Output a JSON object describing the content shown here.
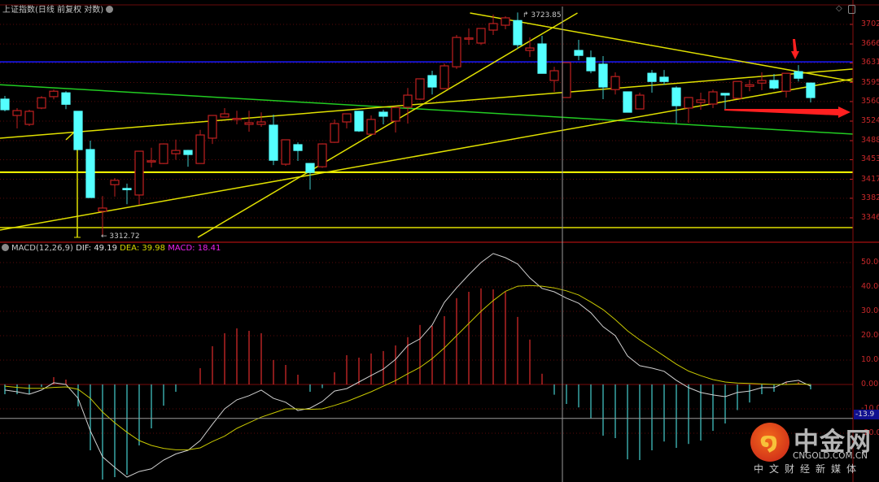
{
  "header": {
    "title": "上证指数(日线 前复权 对数)",
    "macd_label": "MACD(12,26,9)",
    "dif": "DIF: 49.19",
    "dea": "DEA: 39.98",
    "macd": "MACD: 18.41"
  },
  "annotations": {
    "high_label": "3723.85",
    "low_label": "3312.72",
    "cursor_value": "-13.9"
  },
  "watermark": {
    "brand": "中金网",
    "domain": "CNGOLD.COM.CN",
    "slogan": "中文财经新媒体"
  },
  "colors": {
    "up": "#e0302f",
    "down": "#54ffff",
    "dif": "#d0d0d0",
    "dea": "#c8c800",
    "axis": "#c8282a",
    "grid": "#5a0a0a"
  },
  "chart_data": [
    {
      "type": "candlestick",
      "title": "上证指数(日线 前复权 对数)",
      "y_ticks": [
        "3702",
        "3666",
        "3631",
        "3595",
        "3560",
        "3524",
        "3488",
        "3453",
        "3417",
        "3382",
        "3346"
      ],
      "ylim": [
        3300,
        3730
      ],
      "candles_ohlc": [
        [
          3564.4,
          3570.4,
          3542,
          3545
        ],
        [
          3534.4,
          3548,
          3510.5,
          3543.4
        ],
        [
          3518,
          3545,
          3515,
          3542
        ],
        [
          3548,
          3570,
          3546,
          3567
        ],
        [
          3569,
          3582,
          3564,
          3579
        ],
        [
          3576,
          3579,
          3546,
          3555
        ],
        [
          3542,
          3542,
          3471,
          3471.6
        ],
        [
          3471.6,
          3488,
          3383,
          3383.4
        ],
        [
          3358,
          3386,
          3312.72,
          3364
        ],
        [
          3407,
          3419,
          3385,
          3415
        ],
        [
          3400,
          3409,
          3371,
          3399
        ],
        [
          3388,
          3469,
          3370,
          3468.6
        ],
        [
          3450,
          3475,
          3439,
          3451
        ],
        [
          3446,
          3483,
          3445,
          3482
        ],
        [
          3464,
          3490,
          3453,
          3470
        ],
        [
          3470,
          3471,
          3440,
          3462.6
        ],
        [
          3446,
          3508,
          3446,
          3498.5
        ],
        [
          3492.6,
          3535,
          3482,
          3534.4
        ],
        [
          3531.5,
          3548,
          3531,
          3537.4
        ],
        [
          3528,
          3543,
          3518,
          3529
        ],
        [
          3518,
          3543,
          3504.5,
          3521
        ],
        [
          3518,
          3540,
          3513.5,
          3522.5
        ],
        [
          3516.5,
          3536,
          3443,
          3452
        ],
        [
          3444.7,
          3490,
          3441.7,
          3489.6
        ],
        [
          3480.6,
          3485,
          3450.7,
          3470
        ],
        [
          3446,
          3447,
          3398,
          3429.7
        ],
        [
          3440,
          3483,
          3438,
          3482
        ],
        [
          3485,
          3527,
          3484,
          3519.5
        ],
        [
          3522.5,
          3538,
          3510.5,
          3537.4
        ],
        [
          3542,
          3543,
          3504,
          3506
        ],
        [
          3500,
          3534.4,
          3499,
          3527
        ],
        [
          3540.4,
          3545,
          3518,
          3533
        ],
        [
          3524,
          3549.4,
          3503,
          3549
        ],
        [
          3549.4,
          3585,
          3519.5,
          3571.8
        ],
        [
          3564.4,
          3602,
          3563,
          3601.8
        ],
        [
          3607.7,
          3616.7,
          3573,
          3586.8
        ],
        [
          3583.8,
          3630,
          3583,
          3625.7
        ],
        [
          3624,
          3682.5,
          3620,
          3678
        ],
        [
          3675,
          3694.5,
          3664.6,
          3677
        ],
        [
          3667.6,
          3695,
          3664,
          3694.5
        ],
        [
          3691.5,
          3720,
          3682.5,
          3703.5
        ],
        [
          3700.5,
          3717,
          3693,
          3714
        ],
        [
          3709,
          3723.85,
          3657,
          3664.6
        ],
        [
          3654,
          3678,
          3642,
          3658.6
        ],
        [
          3666,
          3681,
          3612,
          3612
        ],
        [
          3598.8,
          3624,
          3577.8,
          3616.7
        ],
        [
          3567.4,
          3632,
          3567,
          3631.7
        ],
        [
          3654,
          3673.6,
          3636,
          3645
        ],
        [
          3640.7,
          3654,
          3612,
          3616.7
        ],
        [
          3628.7,
          3643.7,
          3564.4,
          3586.8
        ],
        [
          3582,
          3613.7,
          3573,
          3606
        ],
        [
          3577.8,
          3578,
          3540.4,
          3540.4
        ],
        [
          3546.4,
          3576.3,
          3546,
          3571.8
        ],
        [
          3612,
          3618,
          3576.3,
          3597
        ],
        [
          3604.8,
          3618,
          3591,
          3597
        ],
        [
          3585,
          3588,
          3519.5,
          3552.4
        ],
        [
          3548,
          3568,
          3521,
          3567.4
        ],
        [
          3558.4,
          3576.3,
          3545,
          3563
        ],
        [
          3555.4,
          3582,
          3548,
          3577.8
        ],
        [
          3575,
          3575,
          3545,
          3572
        ],
        [
          3566,
          3597,
          3565,
          3597
        ],
        [
          3588,
          3600,
          3579,
          3591
        ],
        [
          3594,
          3613.7,
          3580.8,
          3598.8
        ],
        [
          3598.8,
          3610.7,
          3582,
          3585
        ],
        [
          3579,
          3612,
          3567.4,
          3612
        ],
        [
          3615,
          3627,
          3597,
          3603
        ],
        [
          3594,
          3595,
          3558.4,
          3567.4
        ]
      ],
      "horizontal_lines": [
        {
          "price": 3633,
          "color": "#1a1aff"
        },
        {
          "price": 3430,
          "color": "#ffff00"
        },
        {
          "price": 3328,
          "color": "#e0e000"
        }
      ],
      "trend_lines_bar_price": [
        {
          "from": [
            -0.4,
            3591
          ],
          "to": [
            69.5,
            3500
          ],
          "color": "#22cc22"
        },
        {
          "from": [
            -0.4,
            3492.6
          ],
          "to": [
            69.5,
            3620
          ],
          "color": "#e0e000"
        },
        {
          "from": [
            -0.4,
            3323.5
          ],
          "to": [
            69.5,
            3602
          ],
          "color": "#e0e000"
        },
        {
          "from": [
            15.8,
            3310
          ],
          "to": [
            46.9,
            3723
          ],
          "color": "#e0e000"
        },
        {
          "from": [
            38.1,
            3723
          ],
          "to": [
            69.5,
            3597
          ],
          "color": "#e0e000"
        }
      ]
    },
    {
      "type": "macd",
      "params": "MACD(12,26,9)",
      "y_ticks": [
        "50.00",
        "40.00",
        "30.00",
        "20.00",
        "10.00",
        "0.00",
        "-10.00",
        "-20.00"
      ],
      "ylim": [
        -40,
        55
      ],
      "histogram": [
        -4,
        -4,
        -4,
        -1,
        3,
        2,
        -9,
        -27,
        -39,
        -38,
        -37,
        -25,
        -18,
        -8.7,
        -3,
        0,
        6.7,
        15.7,
        21,
        23,
        22,
        21,
        10,
        8,
        4,
        -3,
        -1.5,
        5,
        12,
        11,
        12.7,
        13.7,
        16,
        19.4,
        24.4,
        24,
        28,
        35.4,
        38,
        39.4,
        39,
        38,
        27.7,
        18.4,
        4.4,
        -4.2,
        -8,
        -9.4,
        -14,
        -21,
        -22,
        -30.7,
        -31,
        -27,
        -23.4,
        -26,
        -24.4,
        -23,
        -19,
        -16,
        -10.5,
        -7.4,
        -4,
        -3,
        1,
        1,
        -2
      ],
      "dif": [
        -2.3,
        -3,
        -4,
        -2.3,
        0.7,
        0,
        -5.7,
        -19,
        -29.7,
        -34,
        -38,
        -35.7,
        -34.6,
        -31,
        -28.5,
        -27,
        -23,
        -16.3,
        -10,
        -6.3,
        -4.6,
        -2.3,
        -5.7,
        -7.3,
        -10.7,
        -9.7,
        -7,
        -2.7,
        -1.7,
        1,
        3.7,
        6.3,
        10.3,
        16,
        18.7,
        24.4,
        33.7,
        39.6,
        45,
        50,
        53.7,
        52,
        49.4,
        43.7,
        39.4,
        38,
        35.4,
        33.3,
        29.4,
        23.7,
        20,
        11.7,
        7.7,
        6.7,
        5.4,
        1.7,
        -1.3,
        -3.3,
        -4.3,
        -5,
        -3.3,
        -2.7,
        -1.3,
        -1.3,
        1,
        1.7,
        -0.7
      ],
      "dea": [
        -0.7,
        -1.2,
        -1.6,
        -1.6,
        -1.2,
        -1,
        -2,
        -5.7,
        -11.3,
        -15.7,
        -19.6,
        -23,
        -25,
        -26.2,
        -26.8,
        -26.8,
        -26,
        -23.4,
        -21.2,
        -18,
        -15.7,
        -13.4,
        -11.7,
        -10,
        -10,
        -10.2,
        -10,
        -8.6,
        -7,
        -5,
        -3,
        -0.7,
        1.6,
        4.4,
        7,
        10.6,
        15,
        20,
        25,
        30,
        34.4,
        38.2,
        40.3,
        40.6,
        40.3,
        39.6,
        38.4,
        36.7,
        33.8,
        30.7,
        26.6,
        22,
        18.3,
        15,
        11.7,
        8.3,
        5.5,
        3.6,
        2,
        1,
        0.6,
        0.4,
        0.2,
        0,
        0,
        0.2,
        0
      ],
      "cursor_value": -13.9
    }
  ]
}
